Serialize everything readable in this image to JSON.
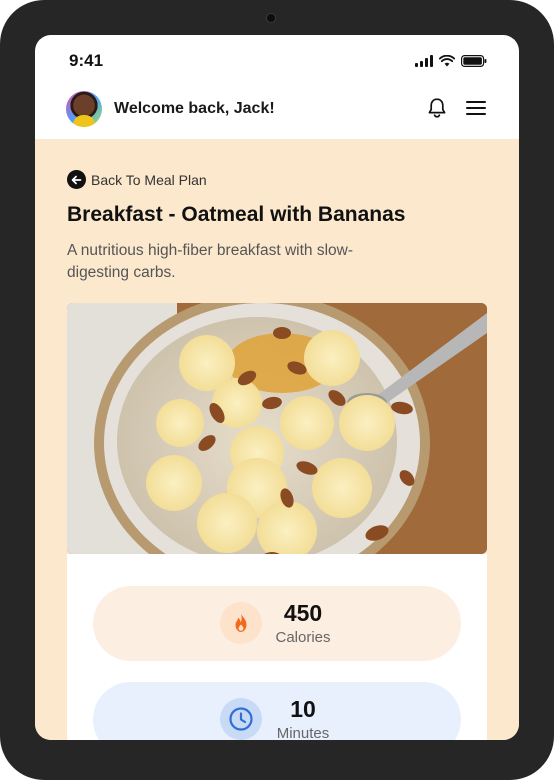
{
  "status_bar": {
    "time": "9:41"
  },
  "header": {
    "welcome_text": "Welcome back, Jack!",
    "avatar_icon": "user-avatar",
    "notification_icon": "bell-icon",
    "menu_icon": "hamburger-menu-icon"
  },
  "page": {
    "back_label": "Back To Meal Plan",
    "title": "Breakfast - Oatmeal with Bananas",
    "description": "A nutritious high-fiber breakfast with slow-digesting carbs."
  },
  "stats": [
    {
      "icon": "flame-icon",
      "value": "450",
      "label": "Calories",
      "accent": "#f26b1d"
    },
    {
      "icon": "clock-icon",
      "value": "10",
      "label": "Minutes",
      "accent": "#2f6fd6"
    }
  ],
  "colors": {
    "content_bg": "#fce8cd",
    "calories_pill": "#fdeee2",
    "minutes_pill": "#e8f0fd"
  }
}
